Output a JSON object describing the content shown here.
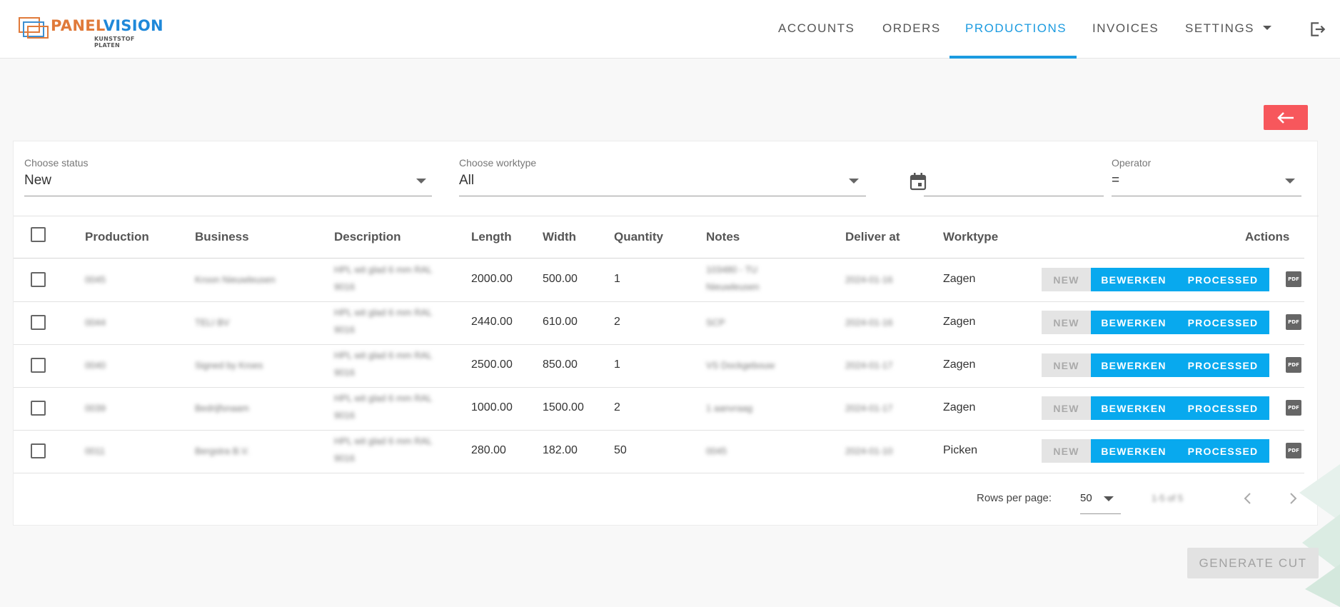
{
  "brand": {
    "part1": "PANEL",
    "part2": "VISION",
    "subtitle": "KUNSTSTOF PLATEN"
  },
  "nav": {
    "items": [
      {
        "label": "ACCOUNTS"
      },
      {
        "label": "ORDERS"
      },
      {
        "label": "PRODUCTIONS"
      },
      {
        "label": "INVOICES"
      },
      {
        "label": "SETTINGS"
      }
    ],
    "active": "PRODUCTIONS"
  },
  "filters": {
    "status": {
      "label": "Choose status",
      "value": "New"
    },
    "worktype": {
      "label": "Choose worktype",
      "value": "All"
    },
    "date": {
      "value": ""
    },
    "operator": {
      "label": "Operator",
      "value": "="
    }
  },
  "table": {
    "columns": [
      "Production",
      "Business",
      "Description",
      "Length",
      "Width",
      "Quantity",
      "Notes",
      "Deliver at",
      "Worktype",
      "Actions"
    ],
    "rows": [
      {
        "production": "0045",
        "business": "Kroon Nieuwleusen",
        "description": "HPL wit glad 6 mm RAL 9016",
        "length": "2000.00",
        "width": "500.00",
        "quantity": "1",
        "notes": "103480 - TU Nieuwleusen",
        "deliver_at": "2024-01-16",
        "worktype": "Zagen"
      },
      {
        "production": "0044",
        "business": "TELI BV",
        "description": "HPL wit glad 6 mm RAL 9016",
        "length": "2440.00",
        "width": "610.00",
        "quantity": "2",
        "notes": "SCP",
        "deliver_at": "2024-01-16",
        "worktype": "Zagen"
      },
      {
        "production": "0040",
        "business": "Signed by Kroes",
        "description": "HPL wit glad 6 mm RAL 9016",
        "length": "2500.00",
        "width": "850.00",
        "quantity": "1",
        "notes": "VS Dockgebouw",
        "deliver_at": "2024-01-17",
        "worktype": "Zagen"
      },
      {
        "production": "0039",
        "business": "Bedrijfsnaam",
        "description": "HPL wit glad 6 mm RAL 9016",
        "length": "1000.00",
        "width": "1500.00",
        "quantity": "2",
        "notes": "1 aanvraag",
        "deliver_at": "2024-01-17",
        "worktype": "Zagen"
      },
      {
        "production": "0011",
        "business": "Bergstra B.V.",
        "description": "HPL wit glad 6 mm RAL 9016",
        "length": "280.00",
        "width": "182.00",
        "quantity": "50",
        "notes": "0045",
        "deliver_at": "2024-01-10",
        "worktype": "Picken"
      }
    ],
    "actions": {
      "new": "NEW",
      "edit": "BEWERKEN",
      "processed": "PROCESSED",
      "pdf": "PDF"
    }
  },
  "pagination": {
    "rows_per_page_label": "Rows per page:",
    "rows_per_page": "50",
    "range": "1-5 of 5"
  },
  "generate_button": "GENERATE CUT",
  "colors": {
    "accent": "#1b9be0",
    "button_blue": "#08a9ee",
    "back_red": "#f7575c"
  }
}
